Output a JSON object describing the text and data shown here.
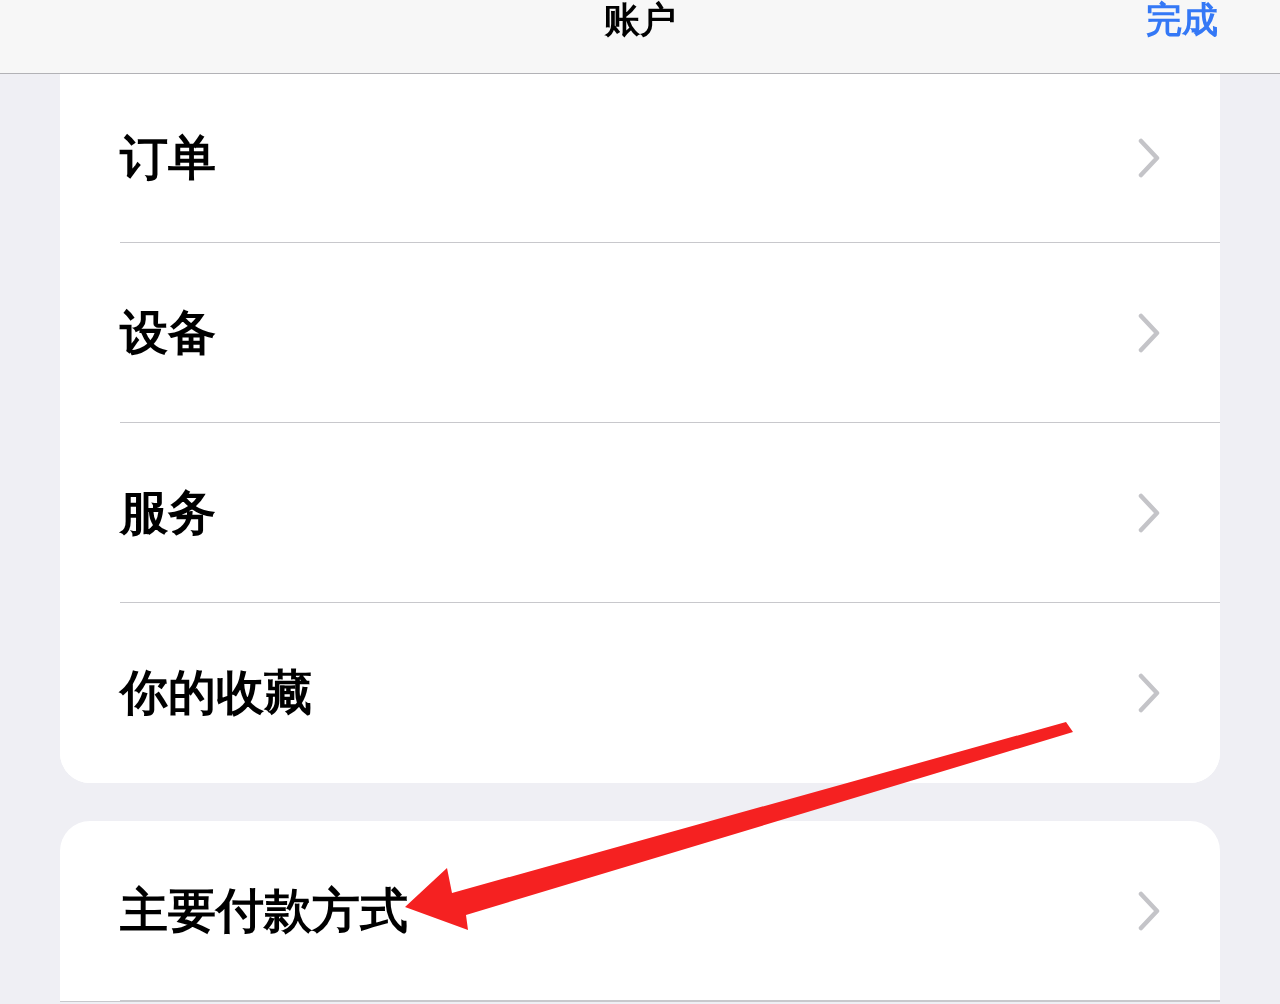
{
  "nav_bar": {
    "title": "账户",
    "done_button": "完成"
  },
  "sections": [
    {
      "rows": [
        {
          "label": "订单"
        },
        {
          "label": "设备"
        },
        {
          "label": "服务"
        },
        {
          "label": "你的收藏"
        }
      ]
    },
    {
      "rows": [
        {
          "label": "主要付款方式"
        }
      ]
    }
  ]
}
